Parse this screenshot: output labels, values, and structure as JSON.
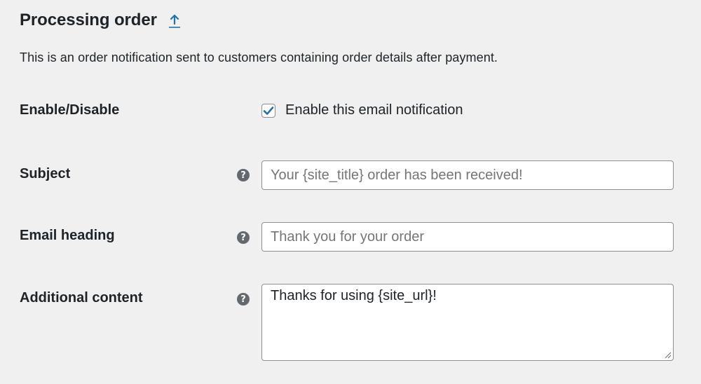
{
  "header": {
    "title": "Processing order",
    "up_link_icon": "arrow-up-icon"
  },
  "description": "This is an order notification sent to customers containing order details after payment.",
  "colors": {
    "background": "#f0f0f1",
    "accent": "#2271b1",
    "help_icon": "#646970",
    "border": "#8c8f94"
  },
  "fields": {
    "enable": {
      "label": "Enable/Disable",
      "checkbox_label": "Enable this email notification",
      "checked": true
    },
    "subject": {
      "label": "Subject",
      "help_icon": "question-icon",
      "placeholder": "Your {site_title} order has been received!",
      "value": ""
    },
    "heading": {
      "label": "Email heading",
      "help_icon": "question-icon",
      "placeholder": "Thank you for your order",
      "value": ""
    },
    "additional": {
      "label": "Additional content",
      "help_icon": "question-icon",
      "value": "Thanks for using {site_url}!"
    }
  }
}
